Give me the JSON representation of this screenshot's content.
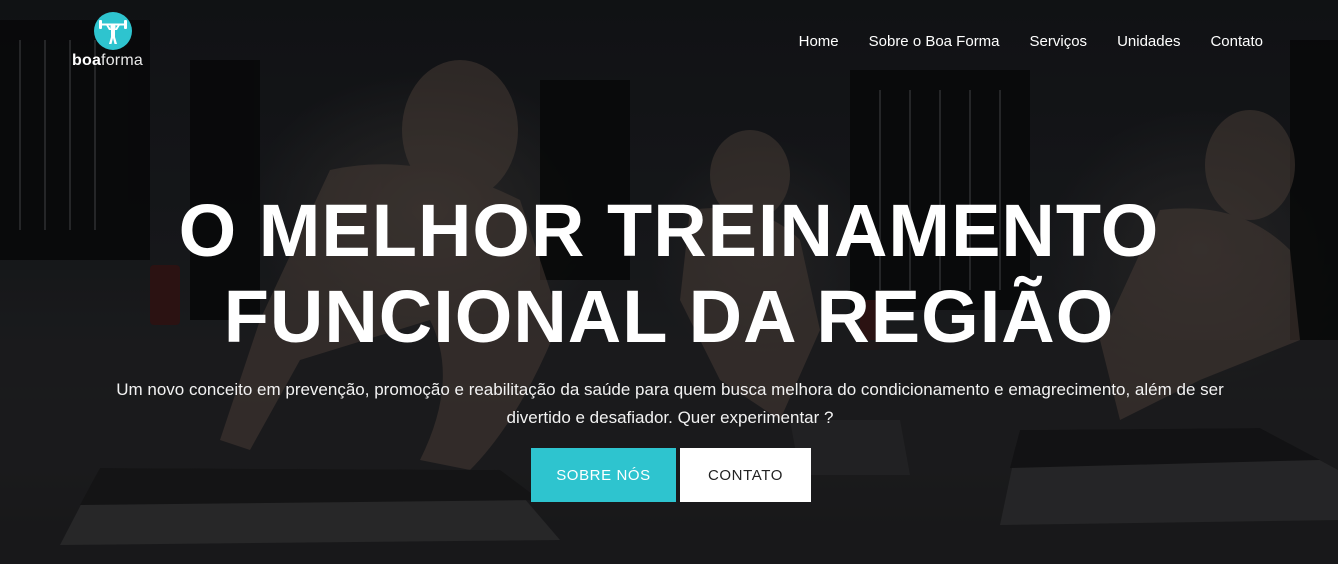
{
  "brand": {
    "logo_icon": "weightlifter-icon",
    "name_bold": "boa",
    "name_light": "forma",
    "accent_color": "#2ec4cf"
  },
  "nav": {
    "items": [
      {
        "label": "Home"
      },
      {
        "label": "Sobre o Boa Forma"
      },
      {
        "label": "Serviços"
      },
      {
        "label": "Unidades"
      },
      {
        "label": "Contato"
      }
    ]
  },
  "hero": {
    "headline_line1": "O MELHOR TREINAMENTO",
    "headline_line2": "FUNCIONAL DA REGIÃO",
    "subtitle": "Um novo conceito em prevenção, promoção e reabilitação da saúde para quem busca melhora do condicionamento e emagrecimento, além de ser divertido e desafiador. Quer experimentar ?",
    "primary_button": "SOBRE NÓS",
    "secondary_button": "CONTATO"
  }
}
